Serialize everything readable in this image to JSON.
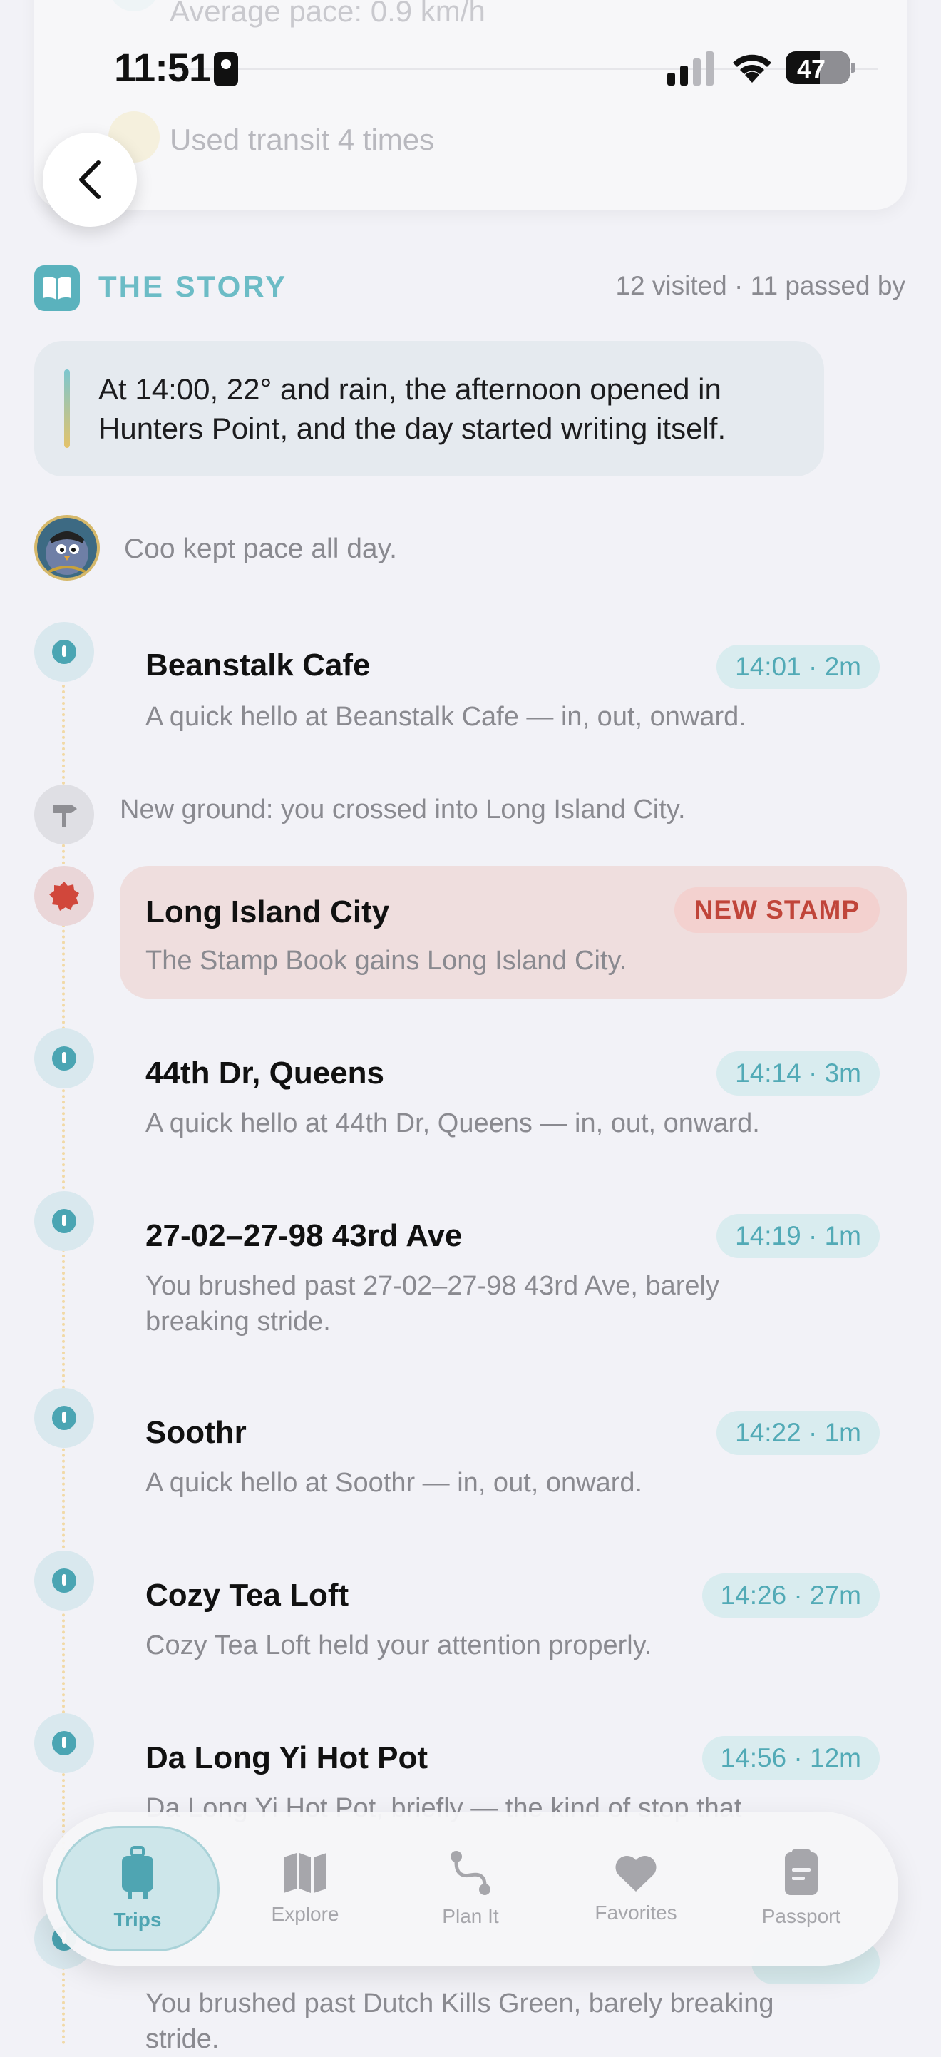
{
  "status_bar": {
    "time": "11:51",
    "battery": "47"
  },
  "stats": {
    "average_pace": "Average pace: 0.9 km/h",
    "transit": "Used transit 4 times"
  },
  "story": {
    "header": "THE STORY",
    "meta": "12 visited · 11 passed by",
    "intro": "At 14:00, 22° and rain, the afternoon opened in Hunters Point, and the day started writing itself.",
    "companion": "Coo kept pace all day."
  },
  "timeline": {
    "e1": {
      "title": "Beanstalk Cafe",
      "time": "14:01 · 2m",
      "subtitle": "A quick hello at Beanstalk Cafe — in, out, onward."
    },
    "ground": "New ground: you crossed into Long Island City.",
    "stamp": {
      "title": "Long Island City",
      "badge": "NEW STAMP",
      "subtitle": "The Stamp Book gains Long Island City."
    },
    "e2": {
      "title": "44th Dr, Queens",
      "time": "14:14 · 3m",
      "subtitle": "A quick hello at 44th Dr, Queens — in, out, onward."
    },
    "e3": {
      "title": "27-02–27-98 43rd Ave",
      "time": "14:19 · 1m",
      "subtitle": "You brushed past 27-02–27-98 43rd Ave, barely breaking stride."
    },
    "e4": {
      "title": "Soothr",
      "time": "14:22 · 1m",
      "subtitle": "A quick hello at Soothr — in, out, onward."
    },
    "e5": {
      "title": "Cozy Tea Loft",
      "time": "14:26 · 27m",
      "subtitle": "Cozy Tea Loft held your attention properly."
    },
    "e6": {
      "title": "Da Long Yi Hot Pot",
      "time": "14:56 · 12m",
      "subtitle": "Da Long Yi Hot Pot, briefly — the kind of stop that"
    },
    "e7": {
      "subtitle": "You brushed past Dutch Kills Green, barely breaking stride."
    }
  },
  "tabs": {
    "trips": "Trips",
    "explore": "Explore",
    "plan": "Plan It",
    "favorites": "Favorites",
    "passport": "Passport"
  },
  "colors": {
    "accent": "#5ab2bd",
    "stamp_red": "#c0453a",
    "background": "#f2f2f7"
  }
}
